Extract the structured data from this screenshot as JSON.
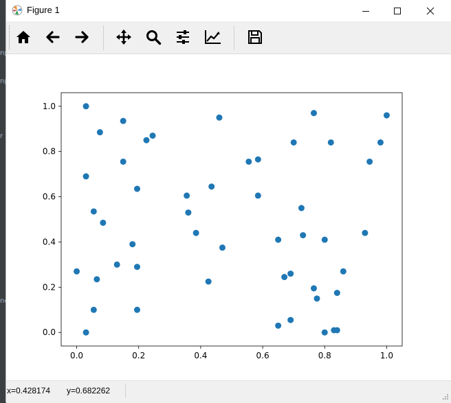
{
  "window": {
    "title": "Figure 1"
  },
  "toolbar": {
    "buttons": [
      "home-icon",
      "back-arrow-icon",
      "forward-arrow-icon",
      "pan-icon",
      "zoom-icon",
      "configure-subplots-icon",
      "edit-axis-icon",
      "save-icon"
    ]
  },
  "status": {
    "x": "x=0.428174",
    "y": "y=0.682262"
  },
  "colors": {
    "marker": "#1f77b4",
    "background": "#ffffff",
    "toolbar": "#f0f0f0"
  },
  "chart_data": {
    "type": "scatter",
    "title": "",
    "xlabel": "",
    "ylabel": "",
    "xlim": [
      -0.05,
      1.05
    ],
    "ylim": [
      -0.06,
      1.06
    ],
    "xticks": [
      0.0,
      0.2,
      0.4,
      0.6,
      0.8,
      1.0
    ],
    "xtick_labels": [
      "0.0",
      "0.2",
      "0.4",
      "0.6",
      "0.8",
      "1.0"
    ],
    "yticks": [
      0.0,
      0.2,
      0.4,
      0.6,
      0.8,
      1.0
    ],
    "ytick_labels": [
      "0.0",
      "0.2",
      "0.4",
      "0.6",
      "0.8",
      "1.0"
    ],
    "grid": false,
    "series": [
      {
        "color": "#1f77b4",
        "points": [
          [
            0.0,
            0.27
          ],
          [
            0.03,
            1.0
          ],
          [
            0.03,
            0.69
          ],
          [
            0.03,
            0.0
          ],
          [
            0.055,
            0.535
          ],
          [
            0.055,
            0.1
          ],
          [
            0.065,
            0.235
          ],
          [
            0.075,
            0.885
          ],
          [
            0.085,
            0.485
          ],
          [
            0.13,
            0.3
          ],
          [
            0.15,
            0.935
          ],
          [
            0.15,
            0.755
          ],
          [
            0.18,
            0.39
          ],
          [
            0.195,
            0.635
          ],
          [
            0.195,
            0.29
          ],
          [
            0.195,
            0.1
          ],
          [
            0.225,
            0.85
          ],
          [
            0.245,
            0.87
          ],
          [
            0.355,
            0.605
          ],
          [
            0.36,
            0.53
          ],
          [
            0.385,
            0.44
          ],
          [
            0.425,
            0.225
          ],
          [
            0.435,
            0.645
          ],
          [
            0.46,
            0.95
          ],
          [
            0.47,
            0.375
          ],
          [
            0.555,
            0.755
          ],
          [
            0.585,
            0.765
          ],
          [
            0.585,
            0.605
          ],
          [
            0.65,
            0.41
          ],
          [
            0.65,
            0.03
          ],
          [
            0.67,
            0.245
          ],
          [
            0.69,
            0.26
          ],
          [
            0.69,
            0.055
          ],
          [
            0.7,
            0.84
          ],
          [
            0.725,
            0.55
          ],
          [
            0.73,
            0.43
          ],
          [
            0.765,
            0.97
          ],
          [
            0.765,
            0.195
          ],
          [
            0.775,
            0.15
          ],
          [
            0.8,
            0.41
          ],
          [
            0.8,
            0.0
          ],
          [
            0.82,
            0.84
          ],
          [
            0.83,
            0.01
          ],
          [
            0.84,
            0.01
          ],
          [
            0.84,
            0.175
          ],
          [
            0.86,
            0.27
          ],
          [
            0.93,
            0.44
          ],
          [
            0.945,
            0.755
          ],
          [
            0.98,
            0.84
          ],
          [
            1.0,
            0.96
          ]
        ]
      }
    ]
  }
}
